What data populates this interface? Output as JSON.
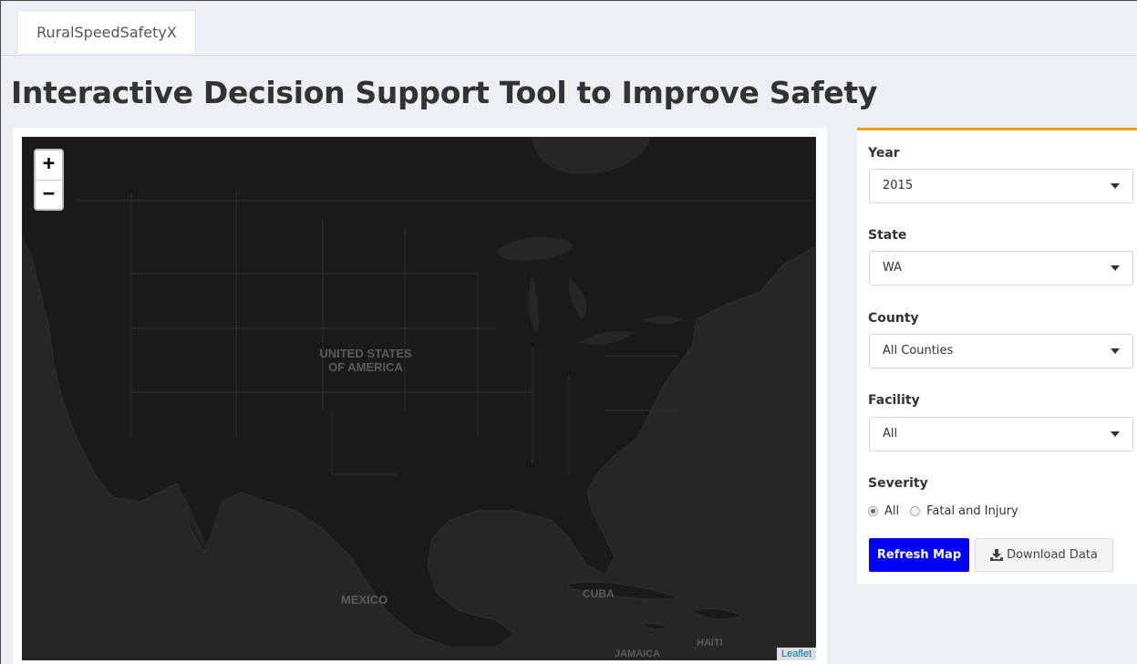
{
  "tabs": [
    {
      "label": "RuralSpeedSafetyX"
    }
  ],
  "page_title": "Interactive Decision Support Tool to Improve Safety",
  "map": {
    "zoom_in": "+",
    "zoom_out": "−",
    "labels": {
      "usa": "UNITED STATES\nOF AMERICA",
      "mexico": "MEXICO",
      "cuba": "CUBA",
      "haiti": "HAITI",
      "jamaica": "JAMAICA"
    },
    "attribution": "Leaflet"
  },
  "filters": {
    "year": {
      "label": "Year",
      "value": "2015"
    },
    "state": {
      "label": "State",
      "value": "WA"
    },
    "county": {
      "label": "County",
      "value": "All Counties"
    },
    "facility": {
      "label": "Facility",
      "value": "All"
    },
    "severity": {
      "label": "Severity",
      "options": [
        {
          "label": "All",
          "selected": true
        },
        {
          "label": "Fatal and Injury",
          "selected": false
        }
      ]
    }
  },
  "buttons": {
    "refresh": "Refresh Map",
    "download": "Download Data"
  },
  "colors": {
    "accent": "#f39c12",
    "primary": "#0000ff",
    "map_bg": "#262626",
    "land": "#1a1a1a"
  }
}
